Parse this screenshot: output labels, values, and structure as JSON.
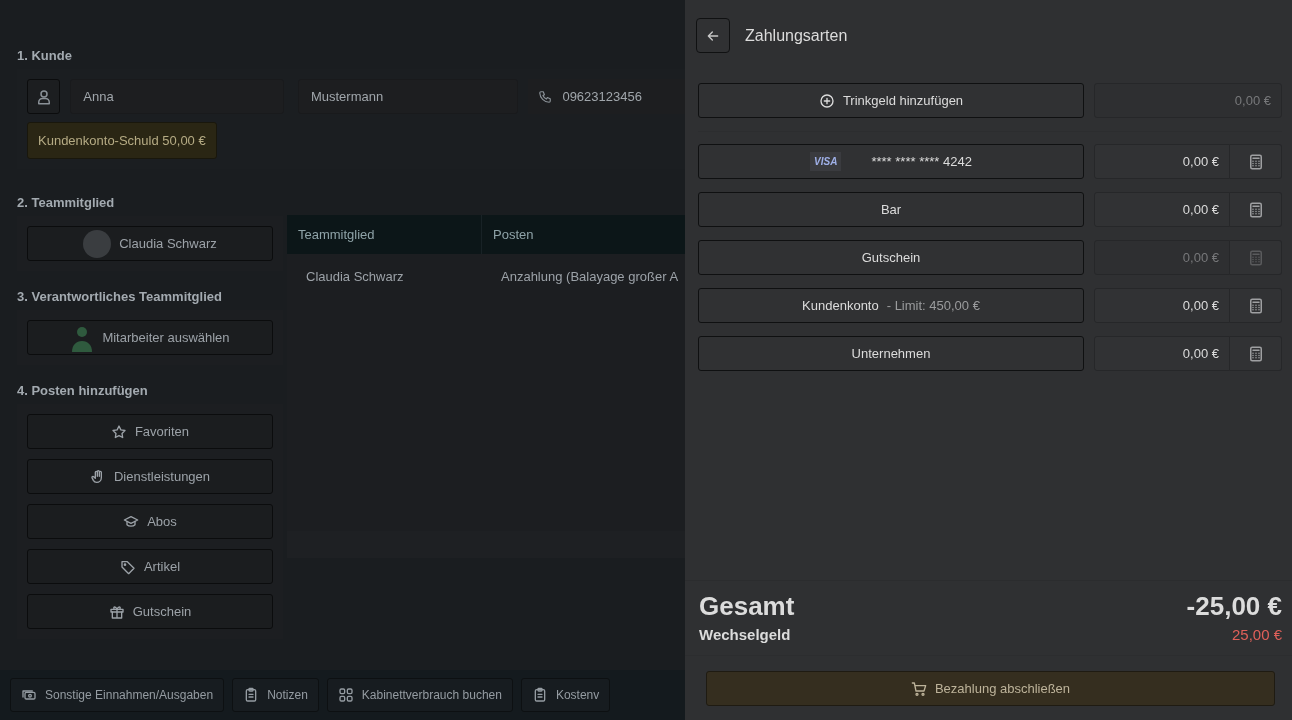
{
  "customer": {
    "heading": "1. Kunde",
    "first_name": "Anna",
    "last_name": "Mustermann",
    "phone": "09623123456",
    "debt_badge": "Kundenkonto-Schuld 50,00 €"
  },
  "team_member": {
    "heading": "2. Teammitglied",
    "name": "Claudia Schwarz"
  },
  "responsible": {
    "heading": "3. Verantwortliches Teammitglied",
    "label": "Mitarbeiter auswählen"
  },
  "add_items": {
    "heading": "4. Posten hinzufügen",
    "buttons": [
      {
        "label": "Favoriten",
        "kind": "star"
      },
      {
        "label": "Dienstleistungen",
        "kind": "hand"
      },
      {
        "label": "Abos",
        "kind": "cap"
      },
      {
        "label": "Artikel",
        "kind": "tag"
      },
      {
        "label": "Gutschein",
        "kind": "gift"
      }
    ]
  },
  "table": {
    "columns": [
      "Teammitglied",
      "Posten"
    ],
    "rows": [
      [
        "Claudia Schwarz",
        "Anzahlung (Balayage großer A"
      ]
    ]
  },
  "bottom_bar": [
    {
      "label": "Sonstige Einnahmen/Ausgaben",
      "kind": "cash"
    },
    {
      "label": "Notizen",
      "kind": "clipboard"
    },
    {
      "label": "Kabinettverbrauch buchen",
      "kind": "grid"
    },
    {
      "label": "Kostenv",
      "kind": "clipboard"
    }
  ],
  "payment_panel": {
    "title": "Zahlungsarten",
    "tip": {
      "label": "Trinkgeld hinzufügen",
      "amount": "0,00 €",
      "disabled": true
    },
    "methods": [
      {
        "kind": "card",
        "brand": "VISA",
        "label": "**** **** **** 4242",
        "amount": "0,00 €",
        "disabled": false
      },
      {
        "kind": "plain",
        "label": "Bar",
        "amount": "0,00 €",
        "disabled": false
      },
      {
        "kind": "plain",
        "label": "Gutschein",
        "amount": "0,00 €",
        "disabled": true
      },
      {
        "kind": "account",
        "label": "Kundenkonto",
        "limit": "- Limit: 450,00 €",
        "amount": "0,00 €",
        "disabled": false
      },
      {
        "kind": "plain",
        "label": "Unternehmen",
        "amount": "0,00 €",
        "disabled": false
      }
    ],
    "total_label": "Gesamt",
    "total": "-25,00 €",
    "change_label": "Wechselgeld",
    "change": "25,00 €",
    "submit": "Bezahlung abschließen"
  }
}
